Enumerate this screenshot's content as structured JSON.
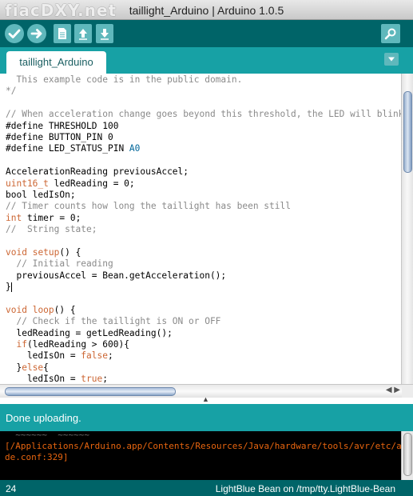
{
  "window": {
    "title": "taillight_Arduino | Arduino 1.0.5",
    "watermark": "fiacDXY.net"
  },
  "toolbar": {
    "buttons": [
      {
        "name": "verify",
        "icon": "checkmark-icon"
      },
      {
        "name": "upload",
        "icon": "arrow-right-icon"
      },
      {
        "name": "new",
        "icon": "new-file-icon"
      },
      {
        "name": "open",
        "icon": "arrow-up-icon"
      },
      {
        "name": "save",
        "icon": "arrow-down-icon"
      },
      {
        "name": "serial-monitor",
        "icon": "magnifier-icon"
      }
    ]
  },
  "tabs": [
    {
      "label": "taillight_Arduino",
      "active": true
    }
  ],
  "editor": {
    "lines": [
      [
        {
          "t": "  This example code is in the public domain.",
          "c": "cm"
        }
      ],
      [
        {
          "t": "*/",
          "c": "cm"
        }
      ],
      [],
      [
        {
          "t": "// When acceleration change goes beyond this threshold, the LED will blink.",
          "c": "cm"
        }
      ],
      [
        {
          "t": "#define THRESHOLD 100",
          "c": "pl"
        }
      ],
      [
        {
          "t": "#define BUTTON_PIN 0",
          "c": "pl"
        }
      ],
      [
        {
          "t": "#define LED_STATUS_PIN ",
          "c": "pl"
        },
        {
          "t": "A0",
          "c": "ct"
        }
      ],
      [],
      [
        {
          "t": "AccelerationReading previousAccel;",
          "c": "pl"
        }
      ],
      [
        {
          "t": "uint16_t",
          "c": "kw"
        },
        {
          "t": " ledReading = 0;",
          "c": "pl"
        }
      ],
      [
        {
          "t": "bool ledIsOn;",
          "c": "pl"
        }
      ],
      [
        {
          "t": "// Timer counts how long the taillight has been still",
          "c": "cm"
        }
      ],
      [
        {
          "t": "int",
          "c": "kw"
        },
        {
          "t": " timer = 0;",
          "c": "pl"
        }
      ],
      [
        {
          "t": "//  String state;",
          "c": "cm"
        }
      ],
      [],
      [
        {
          "t": "void",
          "c": "kw"
        },
        {
          "t": " ",
          "c": "pl"
        },
        {
          "t": "setup",
          "c": "kw"
        },
        {
          "t": "() ",
          "c": "pl"
        },
        {
          "t": "{",
          "c": "hl"
        }
      ],
      [
        {
          "t": "  // Initial reading",
          "c": "cm"
        }
      ],
      [
        {
          "t": "  previousAccel = Bean.getAcceleration();",
          "c": "pl"
        }
      ],
      [
        {
          "t": "}",
          "c": "hl"
        },
        {
          "t": "",
          "c": "caret"
        }
      ],
      [],
      [
        {
          "t": "void",
          "c": "kw"
        },
        {
          "t": " ",
          "c": "pl"
        },
        {
          "t": "loop",
          "c": "kw"
        },
        {
          "t": "() {",
          "c": "pl"
        }
      ],
      [
        {
          "t": "  // Check if the taillight is ON or OFF",
          "c": "cm"
        }
      ],
      [
        {
          "t": "  ledReading = getLedReading();",
          "c": "pl"
        }
      ],
      [
        {
          "t": "  ",
          "c": "pl"
        },
        {
          "t": "if",
          "c": "kw"
        },
        {
          "t": "(ledReading > 600){",
          "c": "pl"
        }
      ],
      [
        {
          "t": "    ledIsOn = ",
          "c": "pl"
        },
        {
          "t": "false",
          "c": "kw"
        },
        {
          "t": ";",
          "c": "pl"
        }
      ],
      [
        {
          "t": "  }",
          "c": "pl"
        },
        {
          "t": "else",
          "c": "kw"
        },
        {
          "t": "{",
          "c": "pl"
        }
      ],
      [
        {
          "t": "    ledIsOn = ",
          "c": "pl"
        },
        {
          "t": "true",
          "c": "kw"
        },
        {
          "t": ";",
          "c": "pl"
        }
      ]
    ]
  },
  "status": {
    "message": "Done uploading."
  },
  "console": {
    "partial_line": "  ~~~~~~  ~~~~~~",
    "lines": [
      "[/Applications/Arduino.app/Contents/Resources/Java/hardware/tools/avr/etc/avrdu",
      "de.conf:329]"
    ]
  },
  "footer": {
    "line_number": "24",
    "board": "LightBlue Bean on /tmp/tty.LightBlue-Bean"
  },
  "colors": {
    "toolbar": "#006468",
    "tabstrip": "#17a1a5",
    "button": "#5fb8bc",
    "keyword": "#cc6633",
    "comment": "#8a8a8a",
    "constant": "#006699",
    "console_text": "#e8650f"
  }
}
